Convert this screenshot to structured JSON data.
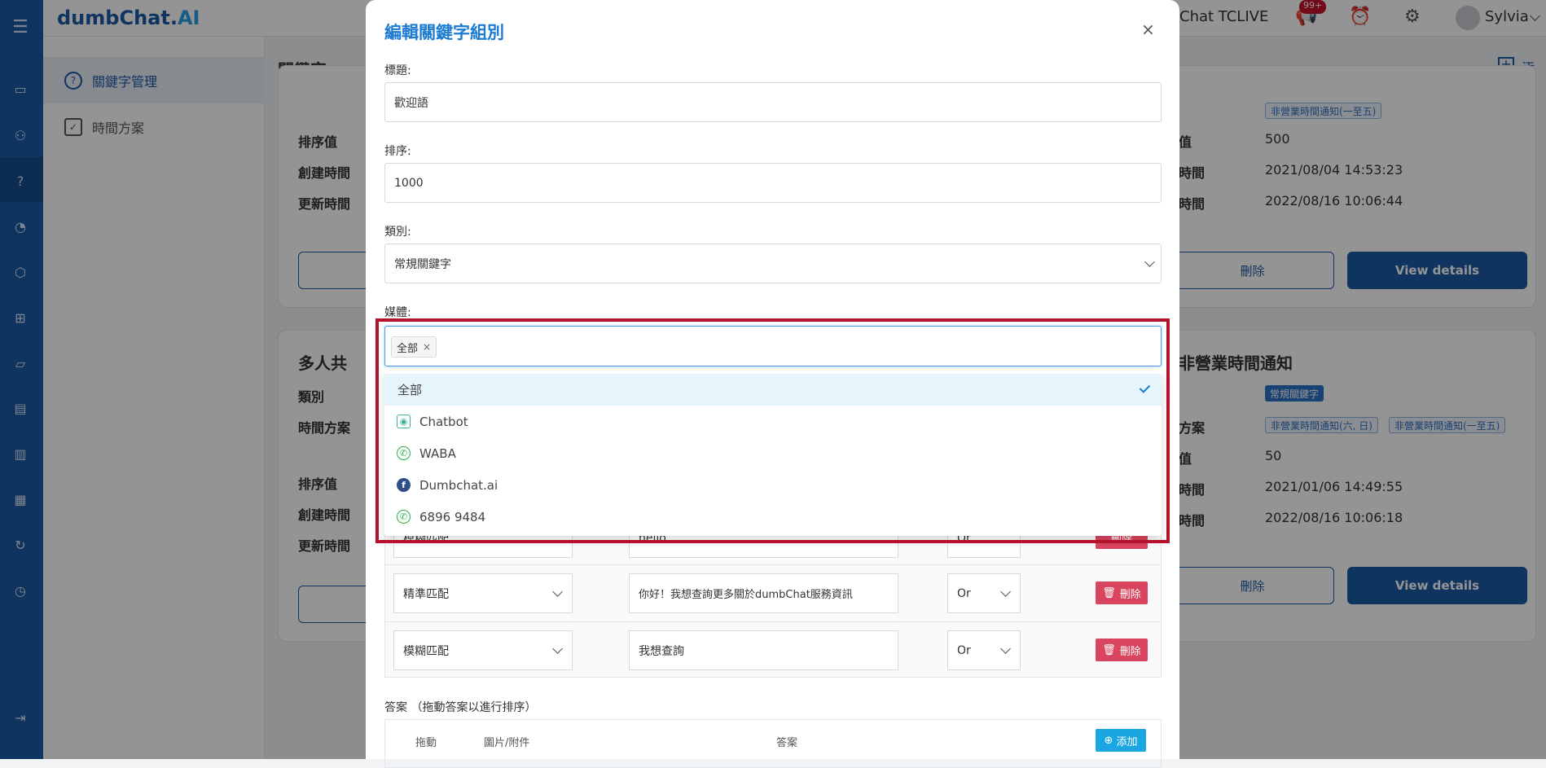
{
  "app": {
    "logo_main": "dumbChat.",
    "logo_ai": "AI",
    "top_right_text": "Chat TCLIVE",
    "notif_badge": "99+",
    "user_name": "Sylvia"
  },
  "sidebar": {
    "items": [
      {
        "label": "關鍵字管理",
        "active": true
      },
      {
        "label": "時間方案",
        "active": false
      }
    ]
  },
  "page": {
    "title": "關鍵字",
    "add_label": "添加"
  },
  "bg_cards": {
    "top_left": {
      "rows": [
        {
          "k": "排序值"
        },
        {
          "k": "創建時間"
        },
        {
          "k": "更新時間"
        }
      ]
    },
    "top_right": {
      "tags": [
        "非營業時間通知(一至五)"
      ],
      "rows": [
        {
          "k": "值",
          "v": "500"
        },
        {
          "k": "時間",
          "v": "2021/08/04 14:53:23"
        },
        {
          "k": "時間",
          "v": "2022/08/16 10:06:44"
        }
      ],
      "delete_label": "刪除",
      "view_label": "View details"
    },
    "bottom_left": {
      "title": "多人共",
      "rows": [
        {
          "k": "類別"
        },
        {
          "k": "時間方案"
        },
        {
          "k": "排序值"
        },
        {
          "k": "創建時間"
        },
        {
          "k": "更新時間"
        }
      ]
    },
    "bottom_right": {
      "title": "非營業時間通知",
      "type_tag": "常規關鍵字",
      "plan_tags": [
        "非營業時間通知(六, 日)",
        "非營業時間通知(一至五)"
      ],
      "rows": [
        {
          "k": "方案"
        },
        {
          "k": "值",
          "v": "50"
        },
        {
          "k": "時間",
          "v": "2021/01/06 14:49:55"
        },
        {
          "k": "時間",
          "v": "2022/08/16 10:06:18"
        }
      ],
      "delete_label": "刪除",
      "view_label": "View details"
    }
  },
  "modal": {
    "title": "編輯關鍵字組別",
    "close": "×",
    "title_label": "標題:",
    "title_value": "歡迎語",
    "order_label": "排序:",
    "order_value": "1000",
    "category_label": "類別:",
    "category_value": "常規關鍵字",
    "media_label": "媒體:",
    "media_selected_chip": "全部",
    "media_options": [
      {
        "label": "全部",
        "icon": "none",
        "selected": true
      },
      {
        "label": "Chatbot",
        "icon": "robot-icon",
        "selected": false
      },
      {
        "label": "WABA",
        "icon": "whatsapp-icon",
        "selected": false
      },
      {
        "label": "Dumbchat.ai",
        "icon": "facebook-icon",
        "selected": false
      },
      {
        "label": "6896 9484",
        "icon": "whatsapp-icon",
        "selected": false
      }
    ],
    "keyword_rows": [
      {
        "match": "模糊匹配",
        "text": "hello",
        "logic": "Or",
        "delete": "刪除"
      },
      {
        "match": "精準匹配",
        "text": "你好！我想查詢更多關於dumbChat服務資訊",
        "logic": "Or",
        "delete": "刪除"
      },
      {
        "match": "模糊匹配",
        "text": "我想查詢",
        "logic": "Or",
        "delete": "刪除"
      }
    ],
    "answers_label": "答案 （拖動答案以進行排序）",
    "answers_headers": {
      "drag": "拖動",
      "image": "圖片/附件",
      "answer": "答案"
    },
    "answers_add": "添加"
  },
  "colors": {
    "brand": "#1b5aa5",
    "accent": "#1b7bd3",
    "danger": "#d9455f",
    "highlight": "#b5122c"
  }
}
